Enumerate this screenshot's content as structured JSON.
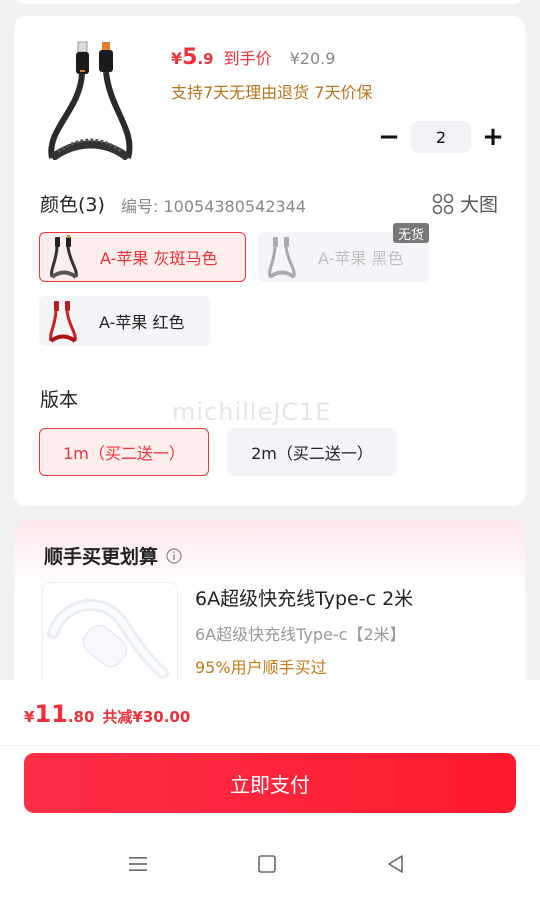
{
  "product": {
    "currency": "¥",
    "price_int": "5",
    "price_dec": ".9",
    "final_label": "到手价",
    "original_price": "¥20.9",
    "promise": "支持7天无理由退货  7天价保",
    "quantity": "2"
  },
  "color_section": {
    "title": "颜色(3)",
    "sku_code": "编号: 10054380542344",
    "big_pic_label": "大图",
    "options": [
      {
        "label": "A-苹果 灰斑马色",
        "selected": true,
        "available": true
      },
      {
        "label": "A-苹果 黑色",
        "selected": false,
        "available": false
      },
      {
        "label": "A-苹果 红色",
        "selected": false,
        "available": true
      }
    ],
    "out_of_stock_badge": "无货"
  },
  "version_section": {
    "title": "版本",
    "options": [
      {
        "label": "1m（买二送一）",
        "selected": true
      },
      {
        "label": "2m（买二送一）",
        "selected": false
      }
    ]
  },
  "watermark": "michilleJC1E",
  "bundle": {
    "title": "顺手买更划算",
    "item_name": "6A超级快充线Type-c 2米",
    "item_spec": "6A超级快充线Type-c【2米】",
    "item_stat": "95%用户顺手买过"
  },
  "footer": {
    "currency": "¥",
    "total_int": "11",
    "total_dec": ".80",
    "savings": "共减¥30.00",
    "pay_label": "立即支付"
  },
  "colors": {
    "accent": "#f0303a",
    "promise": "#b5761d",
    "pay_button": "#ff2f48"
  }
}
